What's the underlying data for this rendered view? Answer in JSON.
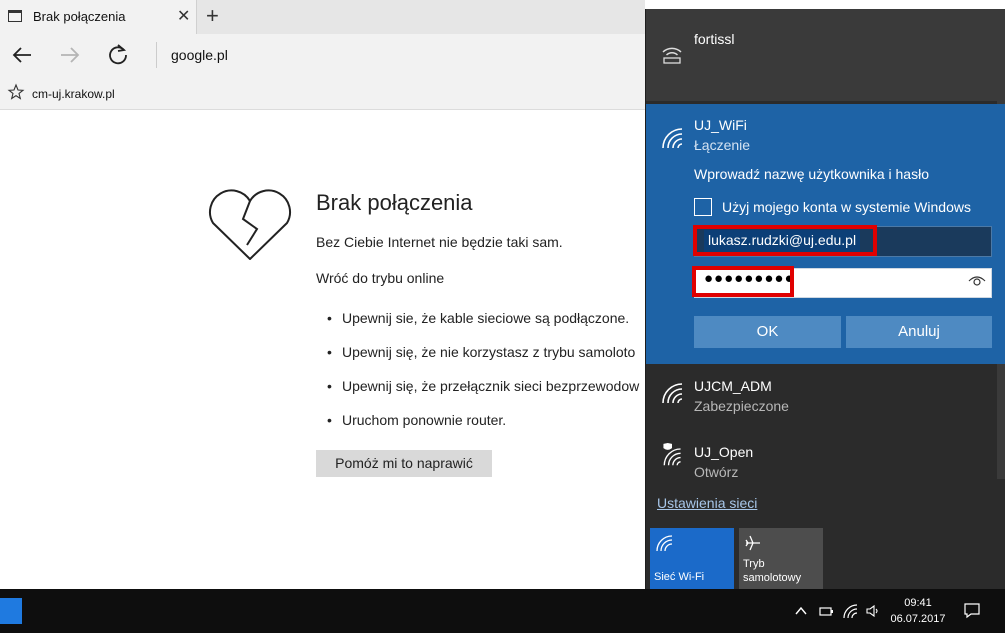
{
  "browser": {
    "tab_title": "Brak połączenia",
    "url": "google.pl",
    "favorite": "cm-uj.krakow.pl"
  },
  "error_page": {
    "title": "Brak połączenia",
    "subtitle": "Bez Ciebie Internet nie będzie taki sam.",
    "online_hint": "Wróć do trybu online",
    "tips": [
      "Upewnij sie, że kable sieciowe są podłączone.",
      "Upewnij się, że nie korzystasz z trybu samoloto",
      "Upewnij się, że przełącznik sieci bezprzewodow",
      "Uruchom ponownie router."
    ],
    "fix_button": "Pomóż mi to naprawić"
  },
  "networks": {
    "fortissl": {
      "name": "fortissl"
    },
    "uj_wifi": {
      "name": "UJ_WiFi",
      "status": "Łączenie",
      "prompt": "Wprowadź nazwę użytkownika i hasło",
      "checkbox_label": "Użyj mojego konta w systemie Windows",
      "username": "lukasz.rudzki@uj.edu.pl",
      "password_mask": "●●●●●●●●●",
      "ok_label": "OK",
      "cancel_label": "Anuluj"
    },
    "ujcm_adm": {
      "name": "UJCM_ADM",
      "status": "Zabezpieczone"
    },
    "uj_open": {
      "name": "UJ_Open",
      "status": "Otwórz"
    },
    "settings_link": "Ustawienia sieci"
  },
  "quick_actions": {
    "wifi_label": "Sieć Wi-Fi",
    "airplane_label_line1": "Tryb",
    "airplane_label_line2": "samolotowy"
  },
  "taskbar": {
    "time": "09:41",
    "date": "06.07.2017"
  },
  "colors": {
    "accent": "#1e63a6",
    "flyout_bg": "#2b2b2b",
    "highlight": "#e00000",
    "wifi_tile": "#1b6ac9"
  }
}
